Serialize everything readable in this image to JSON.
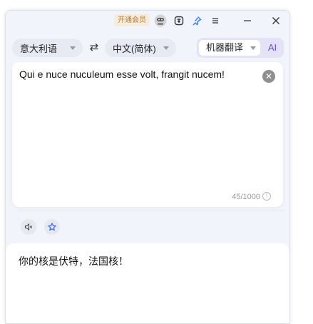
{
  "titlebar": {
    "vip_label": "开通会员",
    "icons": [
      "avatar-icon",
      "screenshot-translate-icon",
      "pin-icon",
      "menu-icon",
      "minimize-icon",
      "close-icon"
    ]
  },
  "lang_bar": {
    "source_lang": "意大利语",
    "target_lang": "中文(简体)",
    "engine": "机器翻译",
    "ai_label": "AI"
  },
  "source": {
    "text": "Qui e nuce nuculeum esse volt, frangit nucem!",
    "char_count": "45/1000"
  },
  "actions": [
    "speaker-icon",
    "star-icon"
  ],
  "result": {
    "text": "你的核是伏特，法国核！"
  },
  "colors": {
    "accent": "#6a4fd8",
    "pin": "#2b7de9",
    "vip_text": "#b77a2f",
    "vip_bg": "#f7ecdc"
  }
}
